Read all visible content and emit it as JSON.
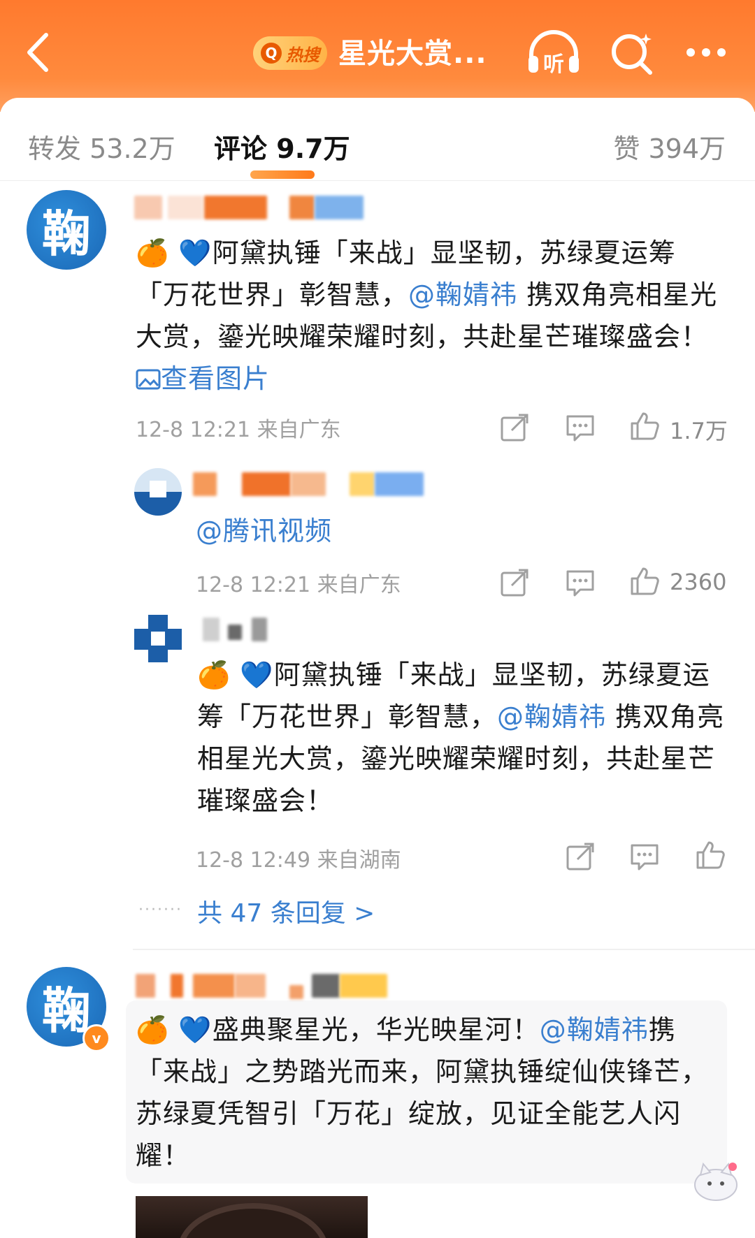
{
  "header": {
    "hot_label": "热搜",
    "title": "星光大赏...",
    "listen_label": "听"
  },
  "tabs": {
    "repost": {
      "label": "转发",
      "count": "53.2万"
    },
    "comments": {
      "label": "评论",
      "count": "9.7万"
    },
    "likes": {
      "label": "赞",
      "count": "394万"
    }
  },
  "comments": [
    {
      "avatar_char": "鞠",
      "text_prefix": "阿黛执锤「来战」显坚韧，苏绿夏运筹「万花世界」彰智慧，",
      "mention": "@鞠婧祎",
      "text_suffix": " 携双角亮相星光大赏，鎏光映耀荣耀时刻，共赴星芒璀璨盛会！",
      "view_image": "查看图片",
      "meta": "12-8 12:21 来自广东",
      "like_count": "1.7万",
      "replies": [
        {
          "text": "@腾讯视频",
          "meta": "12-8 12:21 来自广东",
          "like_count": "2360"
        },
        {
          "text_prefix": "阿黛执锤「来战」显坚韧，苏绿夏运筹「万花世界」彰智慧，",
          "mention": "@鞠婧祎",
          "text_suffix": " 携双角亮相星光大赏，鎏光映耀荣耀时刻，共赴星芒璀璨盛会！",
          "meta": "12-8 12:49 来自湖南",
          "like_count": ""
        }
      ],
      "more_replies": "共 47 条回复 >"
    },
    {
      "avatar_char": "鞠",
      "verified": "v",
      "text_prefix": "盛典聚星光，华光映星河！",
      "mention": "@鞠婧祎",
      "text_suffix": "携「来战」之势踏光而来，阿黛执锤绽仙侠锋芒，苏绿夏凭智引「万花」绽放，见证全能艺人闪耀！"
    }
  ],
  "emoji": {
    "orange": "🍊",
    "heart": "💙"
  },
  "colors": {
    "header": "#ff7a2e",
    "link": "#3a7fcf",
    "avatar": "#1a67b5",
    "accent": "#ff7a1a"
  }
}
